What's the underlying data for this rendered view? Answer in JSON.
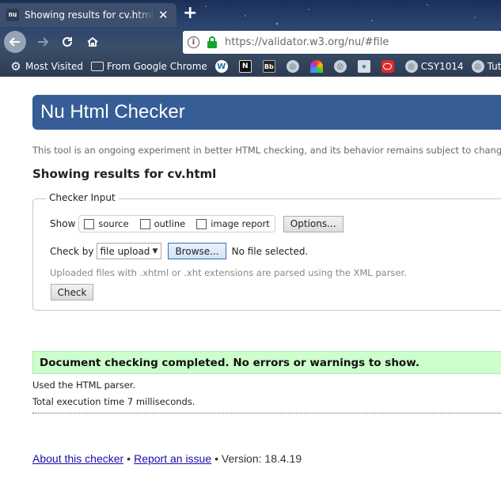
{
  "browser": {
    "tab": {
      "favicon": "nu",
      "title": "Showing results for cv.html - Nu",
      "close_glyph": "✕"
    },
    "new_tab_glyph": "+",
    "url": "https://validator.w3.org/nu/#file",
    "bookmarks": [
      {
        "icon": "gear-icon",
        "label": "Most Visited"
      },
      {
        "icon": "folder-icon",
        "label": "From Google Chrome"
      },
      {
        "icon": "wordpress-icon",
        "label": ""
      },
      {
        "icon": "un-icon",
        "label": ""
      },
      {
        "icon": "bb-icon",
        "label": ""
      },
      {
        "icon": "globe-icon",
        "label": ""
      },
      {
        "icon": "rainbow-icon",
        "label": ""
      },
      {
        "icon": "globe-icon",
        "label": ""
      },
      {
        "icon": "cisco-icon",
        "label": ""
      },
      {
        "icon": "oracle-icon",
        "label": ""
      },
      {
        "icon": "globe-icon",
        "label": "CSY1014"
      },
      {
        "icon": "globe-icon",
        "label": "Tuto"
      }
    ],
    "colors": {
      "accent_lock": "#14a52a"
    }
  },
  "page": {
    "title": "Nu Html Checker",
    "tagline": "This tool is an ongoing experiment in better HTML checking, and its behavior remains subject to change",
    "results_heading": "Showing results for cv.html",
    "checker_input": {
      "legend": "Checker Input",
      "show_label": "Show",
      "checkboxes": [
        "source",
        "outline",
        "image report"
      ],
      "options_button": "Options...",
      "check_by_label": "Check by",
      "check_by_value": "file upload",
      "browse_button": "Browse...",
      "file_status": "No file selected.",
      "note": "Uploaded files with .xhtml or .xht extensions are parsed using the XML parser.",
      "check_button": "Check"
    },
    "success_message": "Document checking completed. No errors or warnings to show.",
    "parser_info": "Used the HTML parser.",
    "execution_info": "Total execution time 7 milliseconds.",
    "footer": {
      "about_link": "About this checker",
      "bullet": "•",
      "report_link": "Report an issue",
      "version_text": "• Version: 18.4.19"
    },
    "colors": {
      "header_bg": "#365d95",
      "success_bg": "#ccffcc"
    }
  }
}
